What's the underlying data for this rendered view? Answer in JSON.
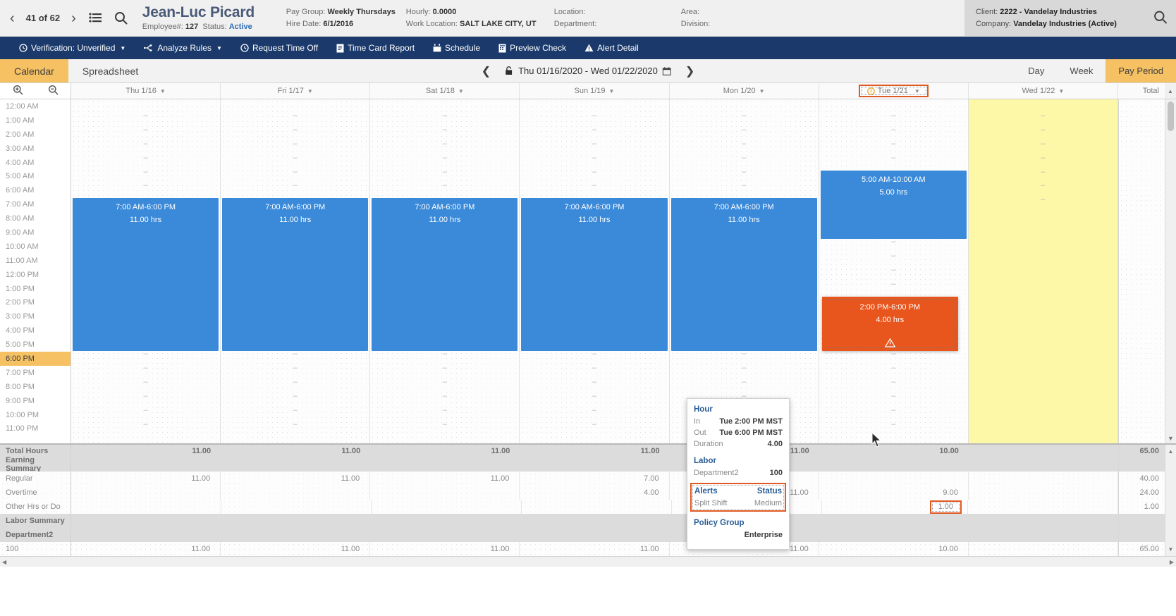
{
  "header": {
    "nav": {
      "prev_icon": "chevron-left-icon",
      "count": "41 of 62",
      "next_icon": "chevron-right-icon",
      "list_icon": "list-icon",
      "search_icon": "search-icon"
    },
    "employee": {
      "name": "Jean-Luc Picard",
      "employee_num_label": "Employee#:",
      "employee_num": "127",
      "status_label": "Status:",
      "status": "Active"
    },
    "pay_group": {
      "label": "Pay Group:",
      "value": "Weekly Thursdays"
    },
    "hire_date": {
      "label": "Hire Date:",
      "value": "6/1/2016"
    },
    "hourly": {
      "label": "Hourly:",
      "value": "0.0000"
    },
    "work_location": {
      "label": "Work Location:",
      "value": "SALT LAKE CITY, UT"
    },
    "location": {
      "label": "Location:",
      "value": ""
    },
    "department": {
      "label": "Department:",
      "value": ""
    },
    "area": {
      "label": "Area:",
      "value": ""
    },
    "division": {
      "label": "Division:",
      "value": ""
    },
    "client": {
      "label": "Client:",
      "value": "2222 - Vandelay Industries"
    },
    "company": {
      "label": "Company:",
      "value": "Vandelay Industries (Active)"
    },
    "client_search_icon": "search-icon"
  },
  "toolbar": {
    "items": [
      {
        "label": "Verification: Unverified",
        "icon": "clock-icon",
        "caret": true
      },
      {
        "label": "Analyze Rules",
        "icon": "analyze-icon",
        "caret": true
      },
      {
        "label": "Request Time Off",
        "icon": "clock-icon",
        "caret": false
      },
      {
        "label": "Time Card Report",
        "icon": "report-icon",
        "caret": false
      },
      {
        "label": "Schedule",
        "icon": "calendar-icon",
        "caret": false
      },
      {
        "label": "Preview Check",
        "icon": "check-icon",
        "caret": false
      },
      {
        "label": "Alert Detail",
        "icon": "warning-icon",
        "caret": false
      }
    ]
  },
  "tabbar": {
    "tabs": [
      {
        "label": "Calendar",
        "active": true
      },
      {
        "label": "Spreadsheet",
        "active": false
      }
    ],
    "date_range": "Thu 01/16/2020 - Wed 01/22/2020",
    "lock_icon": "lock-icon",
    "calendar_icon": "calendar-icon",
    "prev_icon": "chevron-left-icon",
    "next_icon": "chevron-right-icon",
    "views": [
      {
        "label": "Day",
        "active": false
      },
      {
        "label": "Week",
        "active": false
      },
      {
        "label": "Pay Period",
        "active": true
      }
    ]
  },
  "calendar": {
    "zoom_in_icon": "zoom-in-icon",
    "zoom_out_icon": "zoom-out-icon",
    "total_header": "Total",
    "days": [
      {
        "label": "Thu 1/16",
        "flagged": false,
        "yellow": false
      },
      {
        "label": "Fri 1/17",
        "flagged": false,
        "yellow": false
      },
      {
        "label": "Sat 1/18",
        "flagged": false,
        "yellow": false
      },
      {
        "label": "Sun 1/19",
        "flagged": false,
        "yellow": false
      },
      {
        "label": "Mon 1/20",
        "flagged": false,
        "yellow": false
      },
      {
        "label": "Tue 1/21",
        "flagged": true,
        "yellow": false,
        "flag_icon": "alert-circle-icon"
      },
      {
        "label": "Wed 1/22",
        "flagged": false,
        "yellow": true
      }
    ],
    "time_labels": [
      "12:00 AM",
      "1:00 AM",
      "2:00 AM",
      "3:00 AM",
      "4:00 AM",
      "5:00 AM",
      "6:00 AM",
      "7:00 AM",
      "8:00 AM",
      "9:00 AM",
      "10:00 AM",
      "11:00 AM",
      "12:00 PM",
      "1:00 PM",
      "2:00 PM",
      "3:00 PM",
      "4:00 PM",
      "5:00 PM",
      "6:00 PM",
      "7:00 PM",
      "8:00 PM",
      "9:00 PM",
      "10:00 PM",
      "11:00 PM"
    ],
    "highlighted_time": "6:00 PM",
    "shifts": [
      {
        "day": 0,
        "range": "7:00 AM-6:00 PM",
        "hours": "11.00 hrs",
        "color": "blue"
      },
      {
        "day": 1,
        "range": "7:00 AM-6:00 PM",
        "hours": "11.00 hrs",
        "color": "blue"
      },
      {
        "day": 2,
        "range": "7:00 AM-6:00 PM",
        "hours": "11.00 hrs",
        "color": "blue"
      },
      {
        "day": 3,
        "range": "7:00 AM-6:00 PM",
        "hours": "11.00 hrs",
        "color": "blue"
      },
      {
        "day": 4,
        "range": "7:00 AM-6:00 PM",
        "hours": "11.00 hrs",
        "color": "blue"
      },
      {
        "day": 5,
        "range": "5:00 AM-10:00 AM",
        "hours": "5.00 hrs",
        "color": "blue"
      },
      {
        "day": 5,
        "range": "2:00 PM-6:00 PM",
        "hours": "4.00 hrs",
        "color": "orange",
        "warn_icon": "warning-icon"
      }
    ]
  },
  "tooltip": {
    "hour_title": "Hour",
    "in_label": "In",
    "in_value": "Tue 2:00 PM MST",
    "out_label": "Out",
    "out_value": "Tue 6:00 PM MST",
    "duration_label": "Duration",
    "duration_value": "4.00",
    "labor_title": "Labor",
    "labor_label": "Department2",
    "labor_value": "100",
    "alerts_title": "Alerts",
    "status_title": "Status",
    "alert_label": "Split Shift",
    "alert_value": "Medium",
    "policy_title": "Policy Group",
    "policy_value": "Enterprise"
  },
  "summary": {
    "rows": [
      {
        "label": "Total Hours",
        "type": "band",
        "values": [
          "11.00",
          "11.00",
          "11.00",
          "11.00",
          "11.00",
          "10.00",
          ""
        ],
        "total": "65.00"
      },
      {
        "label": "Earning Summary",
        "type": "band",
        "values": [
          "",
          "",
          "",
          "",
          "",
          "",
          ""
        ],
        "total": ""
      },
      {
        "label": "Regular",
        "type": "data",
        "values": [
          "11.00",
          "11.00",
          "11.00",
          "7.00",
          "",
          "",
          ""
        ],
        "total": "40.00"
      },
      {
        "label": "Overtime",
        "type": "data",
        "values": [
          "",
          "",
          "",
          "4.00",
          "11.00",
          "9.00",
          ""
        ],
        "total": "24.00"
      },
      {
        "label": "Other Hrs or Do",
        "type": "data",
        "values": [
          "",
          "",
          "",
          "",
          "",
          "1.00",
          ""
        ],
        "total": "1.00",
        "highlight_index": 5
      },
      {
        "label": "Labor Summary",
        "type": "band",
        "values": [
          "",
          "",
          "",
          "",
          "",
          "",
          ""
        ],
        "total": ""
      },
      {
        "label": "Department2",
        "type": "band",
        "values": [
          "",
          "",
          "",
          "",
          "",
          "",
          ""
        ],
        "total": ""
      },
      {
        "label": "100",
        "type": "data",
        "values": [
          "11.00",
          "11.00",
          "11.00",
          "11.00",
          "11.00",
          "10.00",
          ""
        ],
        "total": "65.00"
      }
    ]
  }
}
